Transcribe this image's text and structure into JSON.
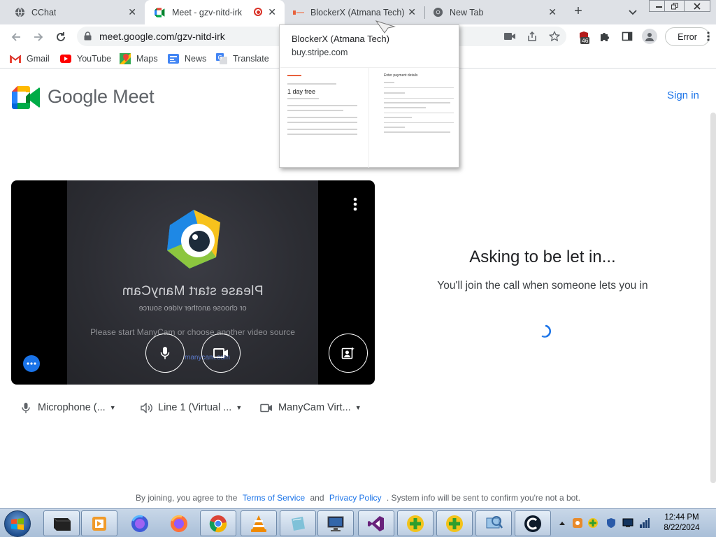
{
  "browser": {
    "tabs": [
      {
        "title": "CChat",
        "icon": "globe-icon",
        "close": "✕"
      },
      {
        "title": "Meet - gzv-nitd-irk",
        "icon": "google-meet-icon",
        "close": "✕",
        "recording": true
      },
      {
        "title": "BlockerX (Atmana Tech)",
        "icon": "stripe-page-icon",
        "close": "✕"
      },
      {
        "title": "New Tab",
        "icon": "chrome-icon",
        "close": "✕"
      }
    ],
    "new_tab_label": "+",
    "url": "meet.google.com/gzv-nitd-irk",
    "extension_badge": "46",
    "profile_button": "Error",
    "bookmarks": [
      {
        "label": "Gmail",
        "icon": "gmail-icon"
      },
      {
        "label": "YouTube",
        "icon": "youtube-icon"
      },
      {
        "label": "Maps",
        "icon": "maps-icon"
      },
      {
        "label": "News",
        "icon": "news-icon"
      },
      {
        "label": "Translate",
        "icon": "translate-icon"
      }
    ],
    "hover_card": {
      "title": "BlockerX (Atmana Tech)",
      "url": "buy.stripe.com",
      "thumb_plan": "1 day free",
      "thumb_heading": "Enter payment details"
    }
  },
  "meet": {
    "brand": "Google Meet",
    "sign_in": "Sign in",
    "preview": {
      "mirrored_title": "Please start ManyCam",
      "mirrored_sub": "or choose another video source",
      "overlay_text": "Please start ManyCam or choose another video source",
      "watermark": "manycam.com"
    },
    "devices": [
      {
        "label": "Microphone (...",
        "icon": "microphone-icon"
      },
      {
        "label": "Line 1 (Virtual ...",
        "icon": "speaker-icon"
      },
      {
        "label": "ManyCam Virt...",
        "icon": "camera-icon"
      }
    ],
    "status": {
      "title": "Asking to be let in...",
      "subtitle": "You'll join the call when someone lets you in"
    },
    "footer": {
      "prefix": "By joining, you agree to the",
      "terms": "Terms of Service",
      "and": "and",
      "privacy": "Privacy Policy",
      "suffix": ". System info will be sent to confirm you're not a bot."
    }
  },
  "taskbar": {
    "time": "12:44 PM",
    "date": "8/22/2024"
  },
  "colors": {
    "accent": "#1a73e8",
    "tabstrip": "#dee1e6",
    "preview_bg": "#000000"
  }
}
